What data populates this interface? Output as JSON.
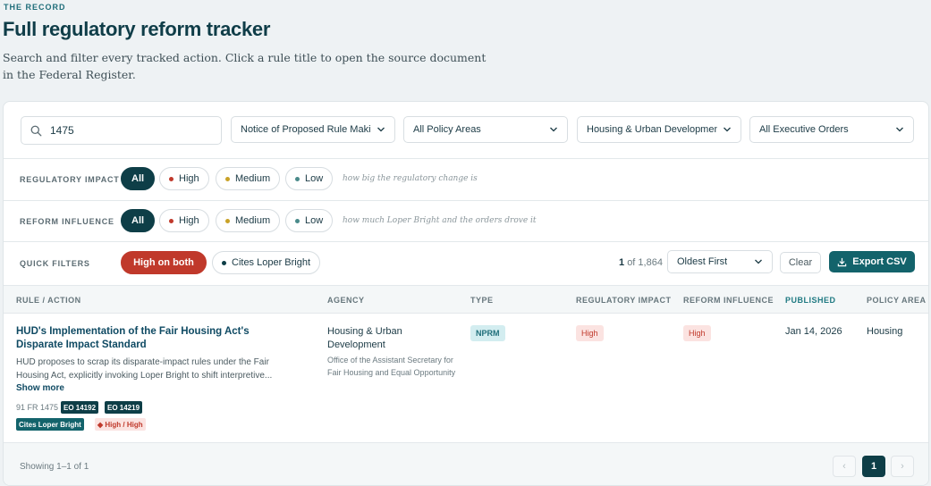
{
  "header": {
    "eyebrow": "THE RECORD",
    "title": "Full regulatory reform tracker",
    "description": "Search and filter every tracked action. Click a rule title to open the source document in the Federal Register."
  },
  "search": {
    "value": "1475",
    "icon": "search-icon"
  },
  "selects": {
    "type": "Notice of Proposed Rule Making",
    "policy_area": "All Policy Areas",
    "agency": "Housing & Urban Development",
    "executive_orders": "All Executive Orders"
  },
  "regulatory_impact": {
    "label": "REGULATORY IMPACT",
    "all": "All",
    "high": "High",
    "medium": "Medium",
    "low": "Low",
    "hint": "how big the regulatory change is"
  },
  "reform_influence": {
    "label": "REFORM INFLUENCE",
    "all": "All",
    "high": "High",
    "medium": "Medium",
    "low": "Low",
    "hint": "how much Loper Bright and the orders drove it"
  },
  "quick_filters": {
    "label": "QUICK FILTERS",
    "high_on_both": "High on both",
    "cites_loper": "Cites Loper Bright"
  },
  "results": {
    "current": "1",
    "total_text": "of 1,864",
    "sort": "Oldest First",
    "clear": "Clear",
    "export": "Export CSV"
  },
  "columns": {
    "rule": "RULE / ACTION",
    "agency": "AGENCY",
    "type": "TYPE",
    "impact": "REGULATORY IMPACT",
    "influence": "REFORM INFLUENCE",
    "published": "PUBLISHED",
    "policy_area": "POLICY AREA"
  },
  "row": {
    "title": "HUD's Implementation of the Fair Housing Act's Disparate Impact Standard",
    "description": "HUD proposes to scrap its disparate-impact rules under the Fair Housing Act, explicitly invoking Loper Bright to shift interpretive...",
    "show_more": "Show more",
    "fr_cite": "91 FR 1475",
    "eo1": "EO 14192",
    "eo2": "EO 14219",
    "cites_tag": "Cites Loper Bright",
    "high_high_tag": "◆ High / High",
    "agency": "Housing & Urban Development",
    "sub_agency": "Office of the Assistant Secretary for Fair Housing and Equal Opportunity",
    "type": "NPRM",
    "impact": "High",
    "influence": "High",
    "published": "Jan 14, 2026",
    "policy_area": "Housing"
  },
  "footer": {
    "showing": "Showing 1–1 of 1",
    "prev": "‹",
    "page": "1",
    "next": "›"
  },
  "colors": {
    "primary": "#0e3e47",
    "accent": "#13636b",
    "high": "#c0392b",
    "medium": "#c9a227",
    "low": "#4a8a8a"
  }
}
